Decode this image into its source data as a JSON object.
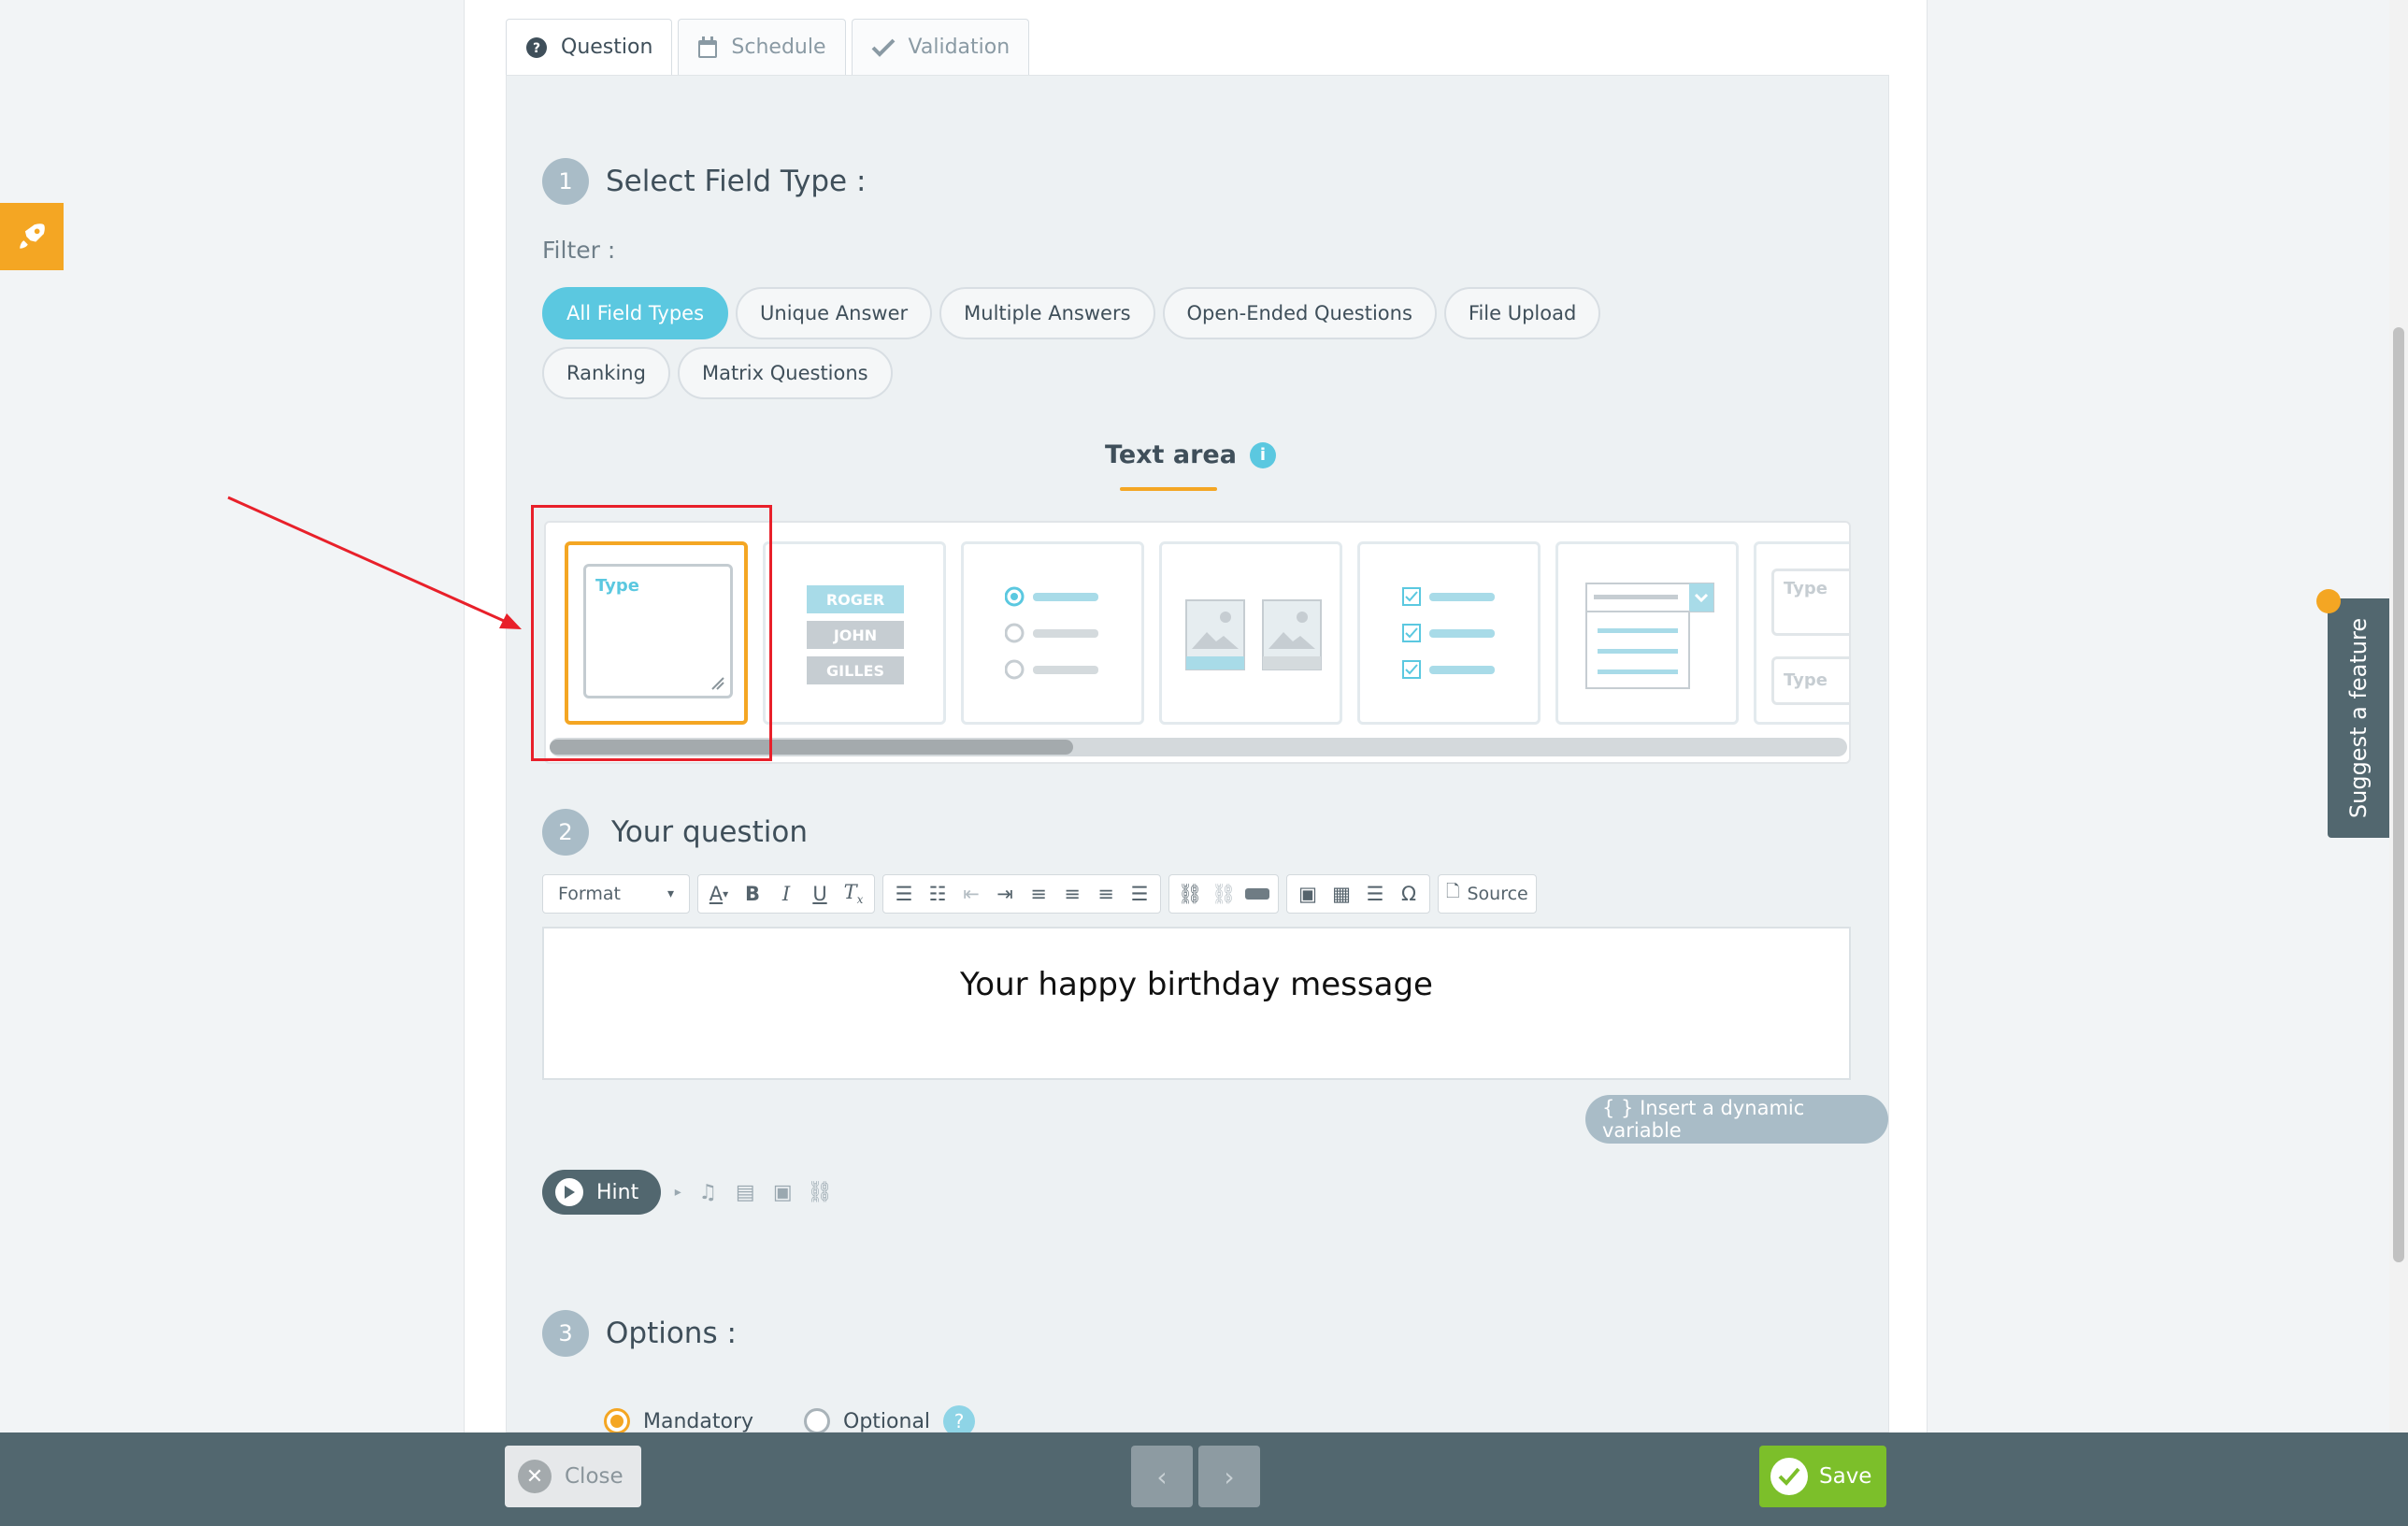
{
  "tabs": [
    {
      "label": "Question",
      "icon": "question-circle-icon",
      "active": true
    },
    {
      "label": "Schedule",
      "icon": "calendar-icon",
      "active": false
    },
    {
      "label": "Validation",
      "icon": "check-icon",
      "active": false
    }
  ],
  "step1": {
    "num": "1",
    "label": "Select Field Type :"
  },
  "filter": {
    "label": "Filter :",
    "chips": [
      "All Field Types",
      "Unique Answer",
      "Multiple Answers",
      "Open-Ended Questions",
      "File Upload",
      "Ranking",
      "Matrix Questions"
    ],
    "active_index": 0
  },
  "field_type": {
    "title": "Text area",
    "info": "i"
  },
  "cards": {
    "textarea_label": "Type",
    "ranking_items": [
      "ROGER",
      "JOHN",
      "GILLES"
    ],
    "partial_labels": [
      "Type",
      "Type"
    ]
  },
  "step2": {
    "num": "2",
    "label": "Your question"
  },
  "editor": {
    "format_label": "Format",
    "source_label": "Source",
    "content": "Your happy birthday message"
  },
  "dynamic_variable": "{ } Insert a dynamic variable",
  "hint": {
    "label": "Hint"
  },
  "step3": {
    "num": "3",
    "label": "Options :"
  },
  "options": {
    "mandatory": "Mandatory",
    "optional": "Optional",
    "help": "?"
  },
  "suggest": "Suggest a feature",
  "bottom": {
    "close": "Close",
    "save": "Save"
  },
  "colors": {
    "accent": "#5bc8e0",
    "orange": "#f4a623",
    "save": "#7cbf2a",
    "bar": "#52676f",
    "annotation": "#e8202a"
  }
}
